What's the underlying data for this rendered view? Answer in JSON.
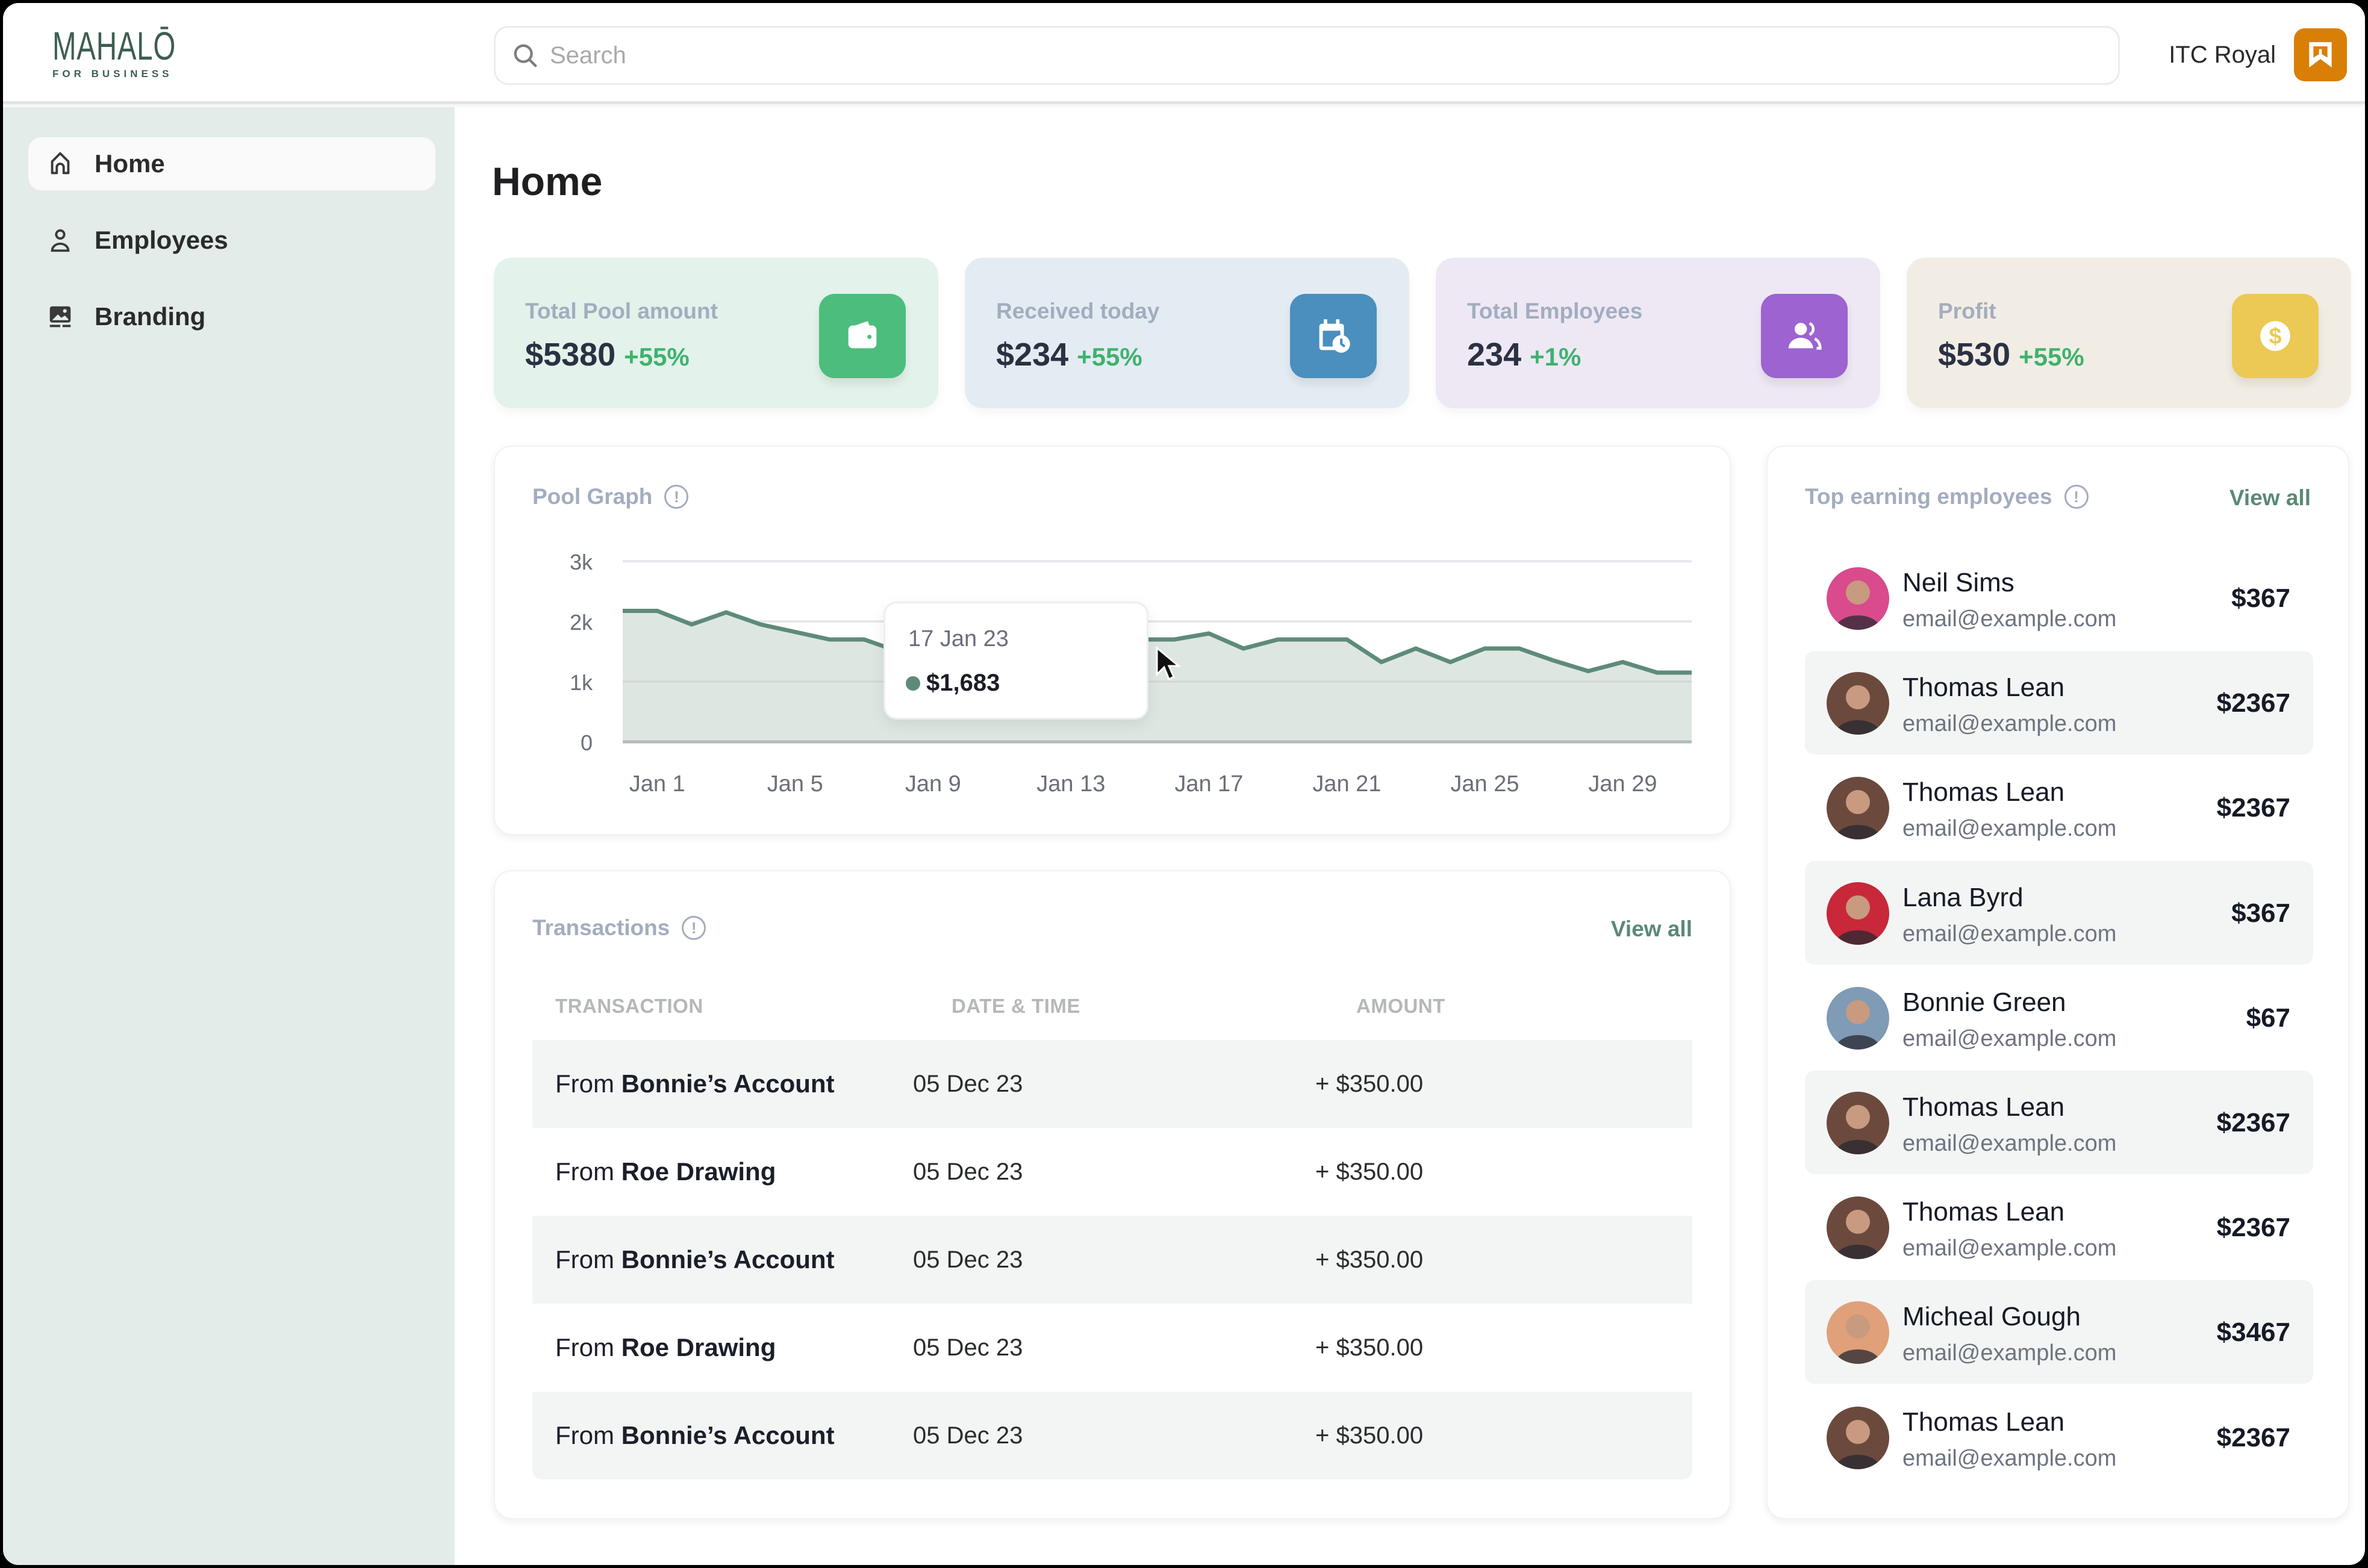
{
  "brand": {
    "name": "MAHALŌ",
    "tagline": "FOR BUSINESS"
  },
  "search": {
    "placeholder": "Search",
    "value": ""
  },
  "account": {
    "name": "ITC Royal",
    "badge_color": "#d97f05"
  },
  "sidebar": {
    "items": [
      {
        "label": "Home",
        "icon": "home-icon",
        "active": true
      },
      {
        "label": "Employees",
        "icon": "user-icon",
        "active": false
      },
      {
        "label": "Branding",
        "icon": "image-icon",
        "active": false
      }
    ]
  },
  "page": {
    "title": "Home"
  },
  "stats": [
    {
      "label": "Total Pool amount",
      "value": "$5380",
      "delta": "+55%",
      "icon": "wallet-icon",
      "bg": "#e3f2ea",
      "icon_bg": "#4cbd7c"
    },
    {
      "label": "Received today",
      "value": "$234",
      "delta": "+55%",
      "icon": "calendar-clock-icon",
      "bg": "#e4ecf3",
      "icon_bg": "#4a8fbd"
    },
    {
      "label": "Total Employees",
      "value": "234",
      "delta": "+1%",
      "icon": "users-icon",
      "bg": "#eee8f5",
      "icon_bg": "#9c63d1"
    },
    {
      "label": "Profit",
      "value": "$530",
      "delta": "+55%",
      "icon": "dollar-icon",
      "bg": "#f2ede4",
      "icon_bg": "#ecc955"
    }
  ],
  "pool_graph": {
    "title": "Pool Graph",
    "tooltip": {
      "date": "17 Jan 23",
      "value": "$1,683"
    }
  },
  "chart_data": {
    "type": "area",
    "title": "Pool Graph",
    "xlabel": "",
    "ylabel": "",
    "ylim": [
      0,
      3000
    ],
    "y_ticks": [
      0,
      1000,
      2000,
      3000
    ],
    "y_tick_labels": [
      "0",
      "1k",
      "2k",
      "3k"
    ],
    "x_tick_labels": [
      "Jan 1",
      "Jan 5",
      "Jan 9",
      "Jan 13",
      "Jan 17",
      "Jan 21",
      "Jan 25",
      "Jan 29"
    ],
    "x_tick_index": [
      1,
      5,
      9,
      13,
      17,
      21,
      25,
      29
    ],
    "grid": true,
    "legend": "none",
    "series": [
      {
        "name": "Pool",
        "color": "#5e8b77",
        "fill": "#dee6e2",
        "x": [
          "Dec 31",
          "Jan 1",
          "Jan 2",
          "Jan 3",
          "Jan 4",
          "Jan 5",
          "Jan 6",
          "Jan 7",
          "Jan 8",
          "Jan 9",
          "Jan 10",
          "Jan 11",
          "Jan 12",
          "Jan 13",
          "Jan 14",
          "Jan 15",
          "Jan 16",
          "Jan 17",
          "Jan 18",
          "Jan 19",
          "Jan 20",
          "Jan 21",
          "Jan 22",
          "Jan 23",
          "Jan 24",
          "Jan 25",
          "Jan 26",
          "Jan 27",
          "Jan 28",
          "Jan 29",
          "Jan 30",
          "Jan 31"
        ],
        "values": [
          2175,
          2175,
          1950,
          2150,
          1950,
          1825,
          1700,
          1700,
          1500,
          1550,
          1600,
          1650,
          1683,
          1700,
          1700,
          1700,
          1700,
          1800,
          1550,
          1700,
          1700,
          1700,
          1325,
          1550,
          1325,
          1550,
          1550,
          1350,
          1175,
          1325,
          1150,
          1150
        ]
      }
    ],
    "annotations": [
      {
        "type": "tooltip",
        "label": "17 Jan 23",
        "value": "$1,683"
      }
    ]
  },
  "transactions": {
    "title": "Transactions",
    "view_all": "View all",
    "columns": [
      "TRANSACTION",
      "DATE & TIME",
      "AMOUNT"
    ],
    "rows": [
      {
        "prefix": "From",
        "source": "Bonnie’s Account",
        "date": "05 Dec 23",
        "amount": "+ $350.00"
      },
      {
        "prefix": "From",
        "source": "Roe Drawing",
        "date": "05 Dec 23",
        "amount": "+ $350.00"
      },
      {
        "prefix": "From",
        "source": "Bonnie’s Account",
        "date": "05 Dec 23",
        "amount": "+ $350.00"
      },
      {
        "prefix": "From",
        "source": "Roe Drawing",
        "date": "05 Dec 23",
        "amount": "+ $350.00"
      },
      {
        "prefix": "From",
        "source": "Bonnie’s Account",
        "date": "05 Dec 23",
        "amount": "+ $350.00"
      }
    ]
  },
  "top_employees": {
    "title": "Top earning employees",
    "view_all": "View all",
    "rows": [
      {
        "name": "Neil Sims",
        "email": "email@example.com",
        "amount": "$367",
        "avatar": "#d94b8c"
      },
      {
        "name": "Thomas Lean",
        "email": "email@example.com",
        "amount": "$2367",
        "avatar": "#6b4a3d"
      },
      {
        "name": "Thomas Lean",
        "email": "email@example.com",
        "amount": "$2367",
        "avatar": "#6b4a3d"
      },
      {
        "name": "Lana Byrd",
        "email": "email@example.com",
        "amount": "$367",
        "avatar": "#c8283a"
      },
      {
        "name": "Bonnie Green",
        "email": "email@example.com",
        "amount": "$67",
        "avatar": "#7f9bb5"
      },
      {
        "name": "Thomas Lean",
        "email": "email@example.com",
        "amount": "$2367",
        "avatar": "#6b4a3d"
      },
      {
        "name": "Thomas Lean",
        "email": "email@example.com",
        "amount": "$2367",
        "avatar": "#6b4a3d"
      },
      {
        "name": "Micheal Gough",
        "email": "email@example.com",
        "amount": "$3467",
        "avatar": "#e0a07a"
      },
      {
        "name": "Thomas Lean",
        "email": "email@example.com",
        "amount": "$2367",
        "avatar": "#6b4a3d"
      }
    ]
  }
}
